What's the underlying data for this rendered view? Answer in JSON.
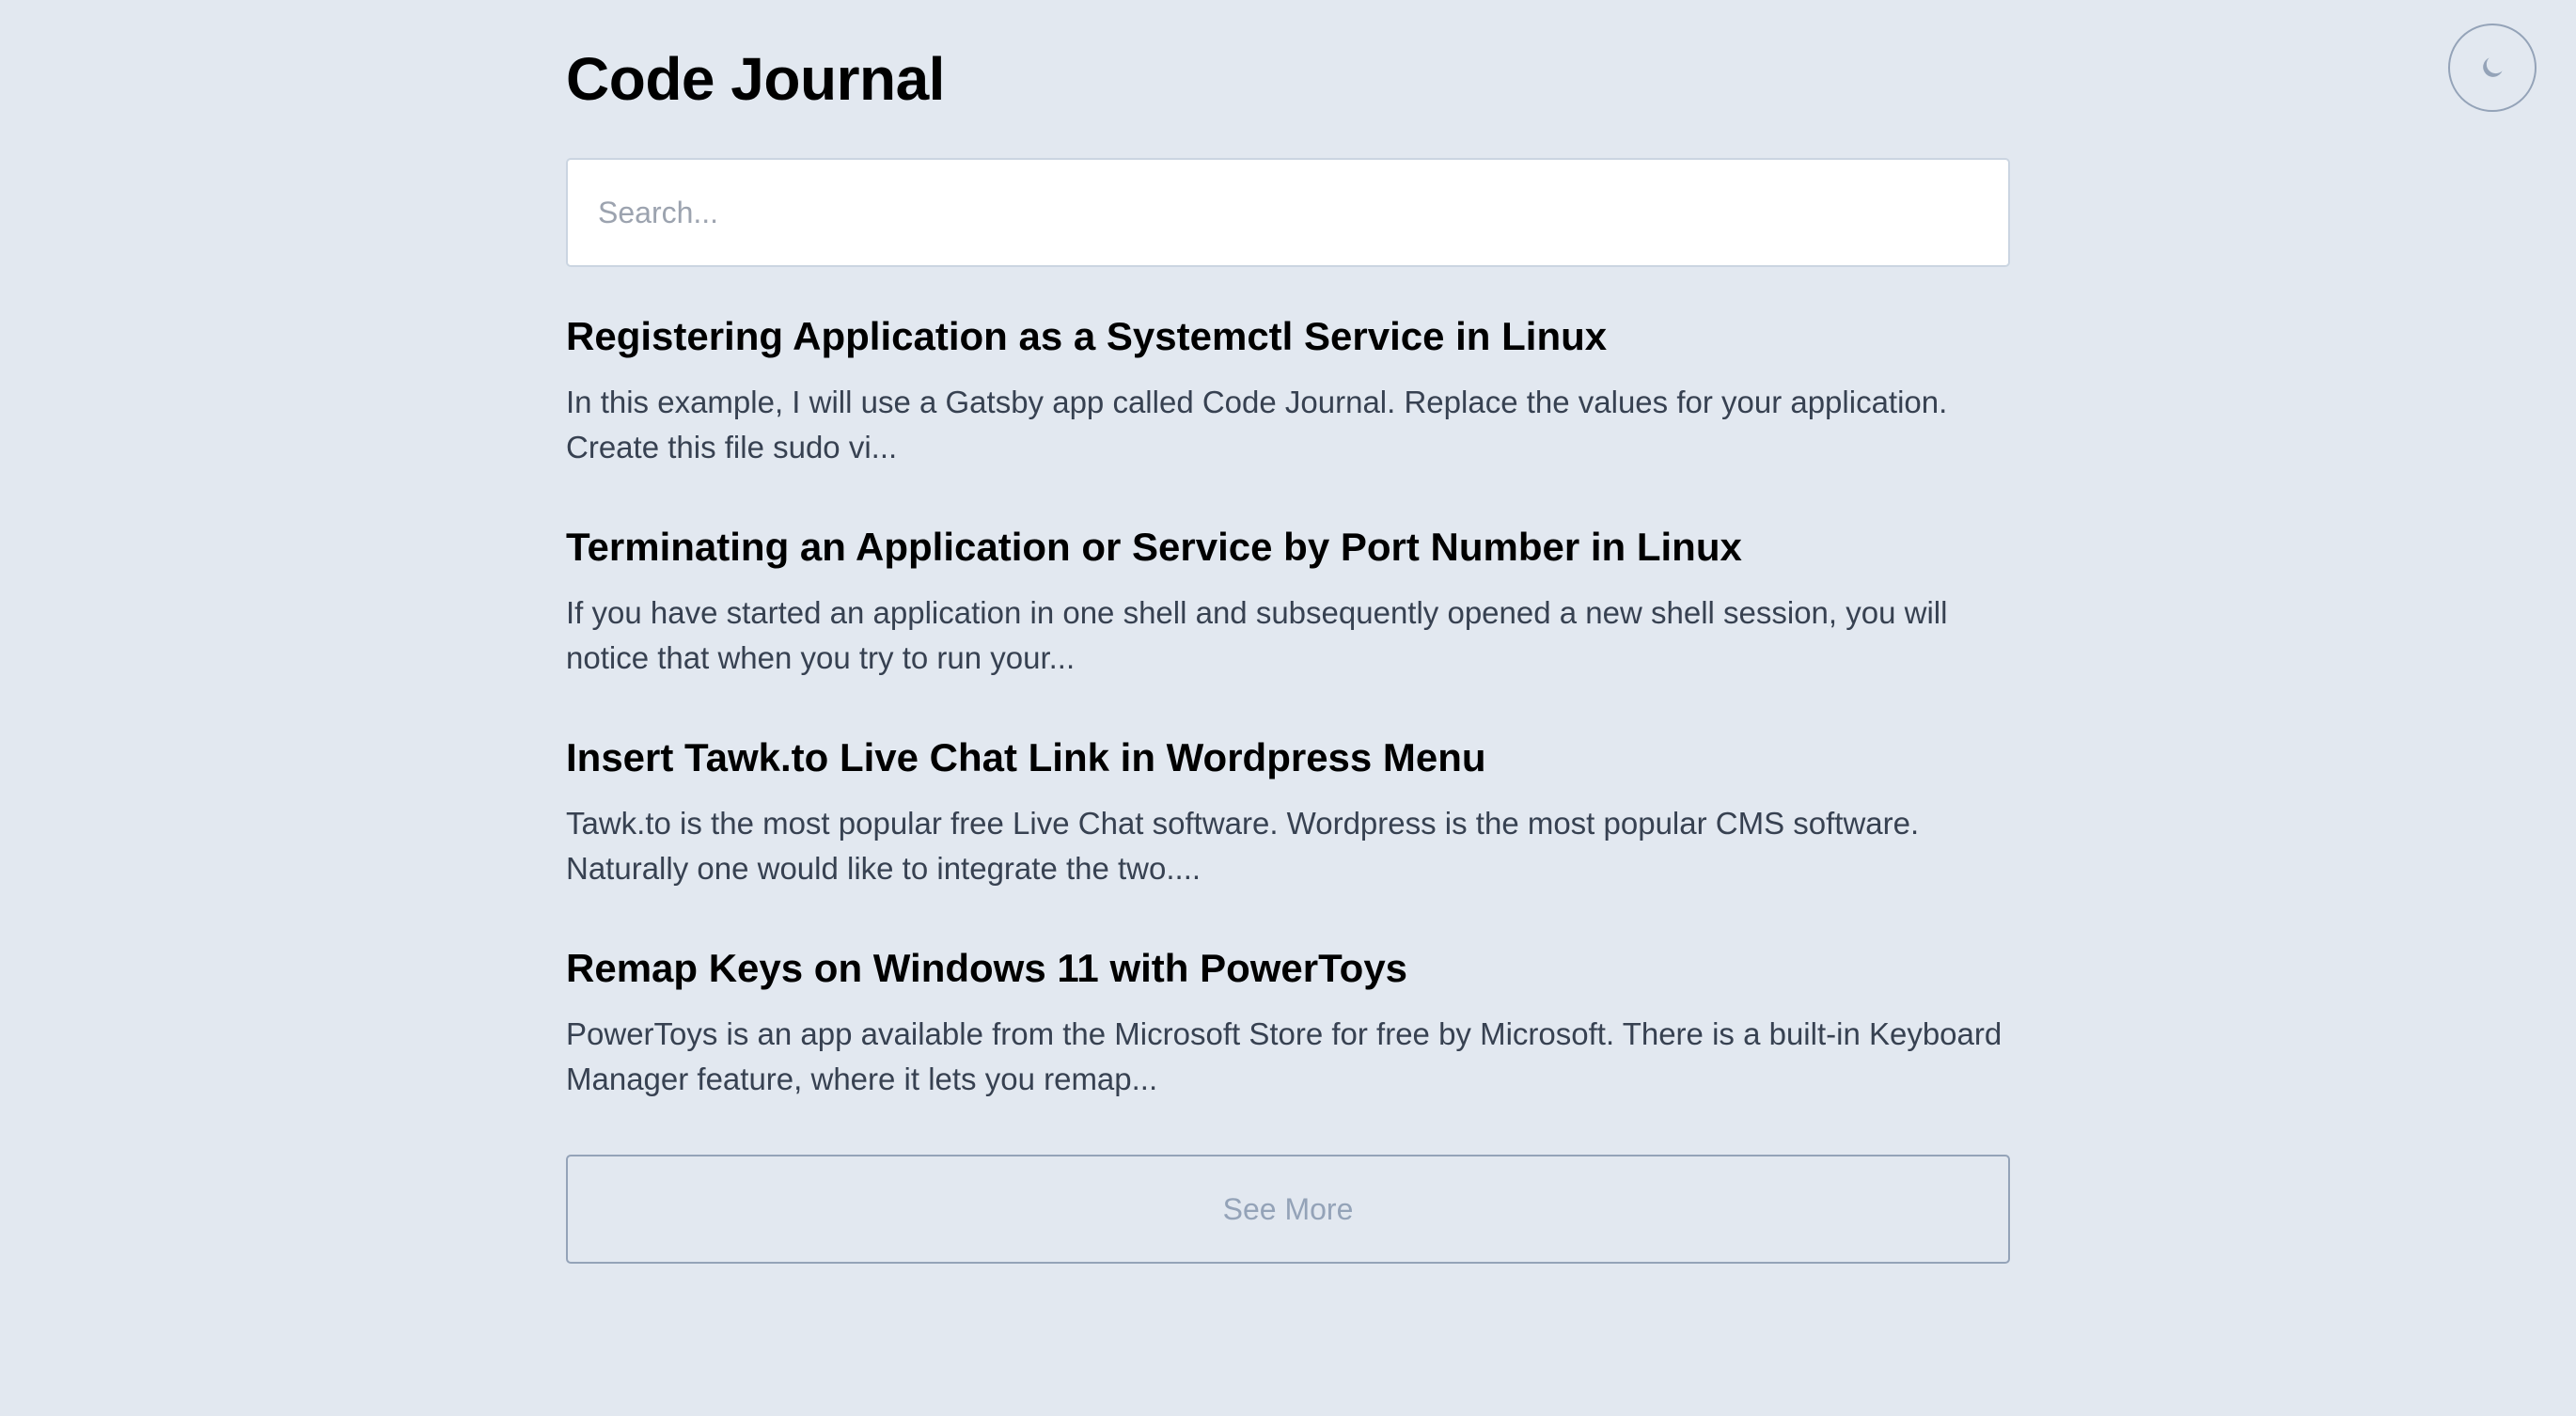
{
  "site": {
    "title": "Code Journal"
  },
  "theme_toggle": {
    "icon": "moon-icon",
    "color": "#94a3b8"
  },
  "search": {
    "placeholder": "Search...",
    "value": ""
  },
  "posts": [
    {
      "title": "Registering Application as a Systemctl Service in Linux",
      "excerpt": "In this example, I will use a Gatsby app called Code Journal. Replace the values for your application. Create this file sudo vi..."
    },
    {
      "title": "Terminating an Application or Service by Port Number in Linux",
      "excerpt": "If you have started an application in one shell and subsequently opened a new shell session, you will notice that when you try to run your..."
    },
    {
      "title": "Insert Tawk.to Live Chat Link in Wordpress Menu",
      "excerpt": "Tawk.to is the most popular free Live Chat software. Wordpress is the most popular CMS software. Naturally one would like to integrate the two...."
    },
    {
      "title": "Remap Keys on Windows 11 with PowerToys",
      "excerpt": "PowerToys is an app available from the Microsoft Store for free by Microsoft. There is a built-in Keyboard Manager feature, where it lets you remap..."
    }
  ],
  "see_more": {
    "label": "See More"
  },
  "colors": {
    "background": "#e2e8f0",
    "text": "#000000",
    "excerpt": "#374151",
    "muted": "#94a3b8"
  }
}
